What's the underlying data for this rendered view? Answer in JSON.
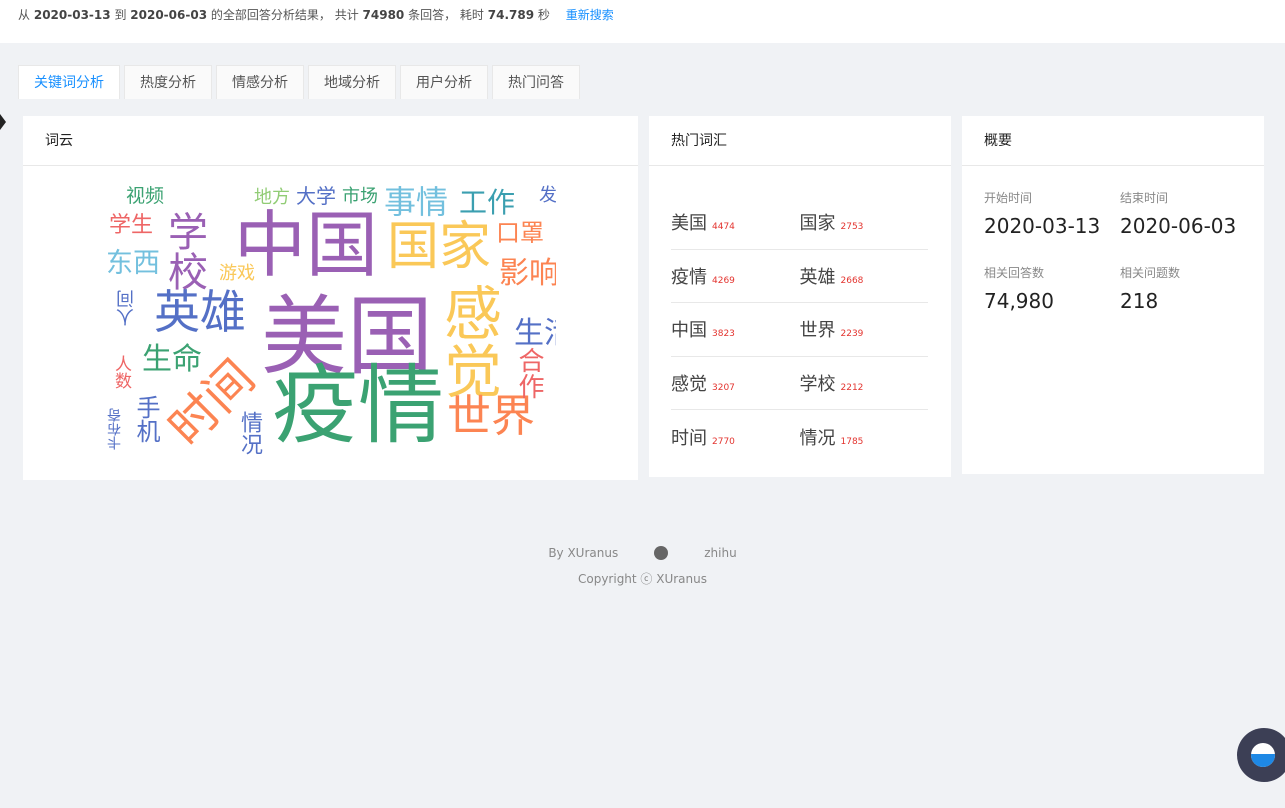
{
  "summary": {
    "prefix": "从",
    "start": "2020-03-13",
    "to": "到",
    "end": "2020-06-03",
    "mid": "的全部回答分析结果， 共计",
    "count": "74980",
    "unit": "条回答， 耗时",
    "time": "74.789",
    "sec": "秒",
    "research": "重新搜索"
  },
  "tabs": [
    "关键词分析",
    "热度分析",
    "情感分析",
    "地域分析",
    "用户分析",
    "热门问答"
  ],
  "wordcloud": {
    "title": "词云",
    "words": [
      "视频",
      "学生",
      "学校",
      "中国",
      "国家",
      "事情",
      "工作",
      "口罩",
      "发",
      "地方",
      "大学",
      "市场",
      "东西",
      "游戏",
      "影响",
      "人间",
      "英雄",
      "美国",
      "感觉",
      "生活",
      "生命",
      "人数",
      "时间",
      "疫情",
      "世界",
      "合作",
      "手机",
      "情况",
      "卡布奇"
    ]
  },
  "hot": {
    "title": "热门词汇",
    "rows": [
      [
        {
          "word": "美国",
          "count": "4474"
        },
        {
          "word": "国家",
          "count": "2753"
        }
      ],
      [
        {
          "word": "疫情",
          "count": "4269"
        },
        {
          "word": "英雄",
          "count": "2668"
        }
      ],
      [
        {
          "word": "中国",
          "count": "3823"
        },
        {
          "word": "世界",
          "count": "2239"
        }
      ],
      [
        {
          "word": "感觉",
          "count": "3207"
        },
        {
          "word": "学校",
          "count": "2212"
        }
      ],
      [
        {
          "word": "时间",
          "count": "2770"
        },
        {
          "word": "情况",
          "count": "1785"
        }
      ]
    ]
  },
  "overview": {
    "title": "概要",
    "start_label": "开始时间",
    "start_value": "2020-03-13",
    "end_label": "结束时间",
    "end_value": "2020-06-03",
    "answers_label": "相关回答数",
    "answers_value": "74,980",
    "questions_label": "相关问题数",
    "questions_value": "218"
  },
  "footer": {
    "by": "By XUranus",
    "zhihu": "zhihu",
    "copyright": "Copyright ⓒ XUranus"
  }
}
